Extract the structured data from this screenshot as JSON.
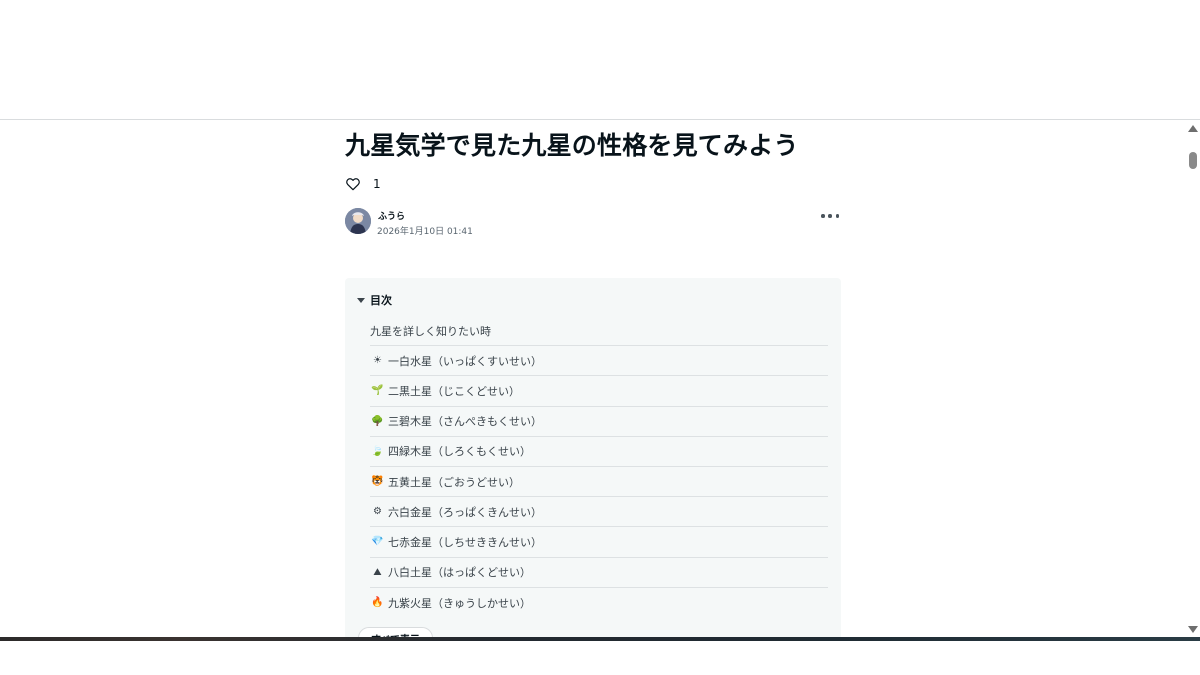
{
  "article": {
    "title": "九星気学で見た九星の性格を見てみよう",
    "like_count": "1",
    "author": {
      "name": "ふうら",
      "date": "2026年1月10日 01:41"
    }
  },
  "toc": {
    "title": "目次",
    "items": [
      {
        "emoji": "",
        "label": "九星を詳しく知りたい時"
      },
      {
        "emoji": "☀",
        "label": "一白水星（いっぱくすいせい）"
      },
      {
        "emoji": "🌱",
        "label": "二黒土星（じこくどせい）"
      },
      {
        "emoji": "🌳",
        "label": "三碧木星（さんぺきもくせい）"
      },
      {
        "emoji": "🍃",
        "label": "四緑木星（しろくもくせい）"
      },
      {
        "emoji": "🐯",
        "label": "五黄土星（ごおうどせい）"
      },
      {
        "emoji": "⚙",
        "label": "六白金星（ろっぱくきんせい）"
      },
      {
        "emoji": "💎",
        "label": "七赤金星（しちせききんせい）"
      },
      {
        "emoji": "⛰",
        "label": "八白土星（はっぱくどせい）"
      },
      {
        "emoji": "🔥",
        "label": "九紫火星（きゅうしかせい）"
      }
    ],
    "show_all_label": "すべて表示"
  },
  "icons": {
    "like": "heart-icon",
    "more": "more-horizontal-icon",
    "toc_toggle": "caret-down-icon",
    "scroll_up": "scroll-up-arrow-icon",
    "scroll_down": "scroll-down-arrow-icon"
  }
}
